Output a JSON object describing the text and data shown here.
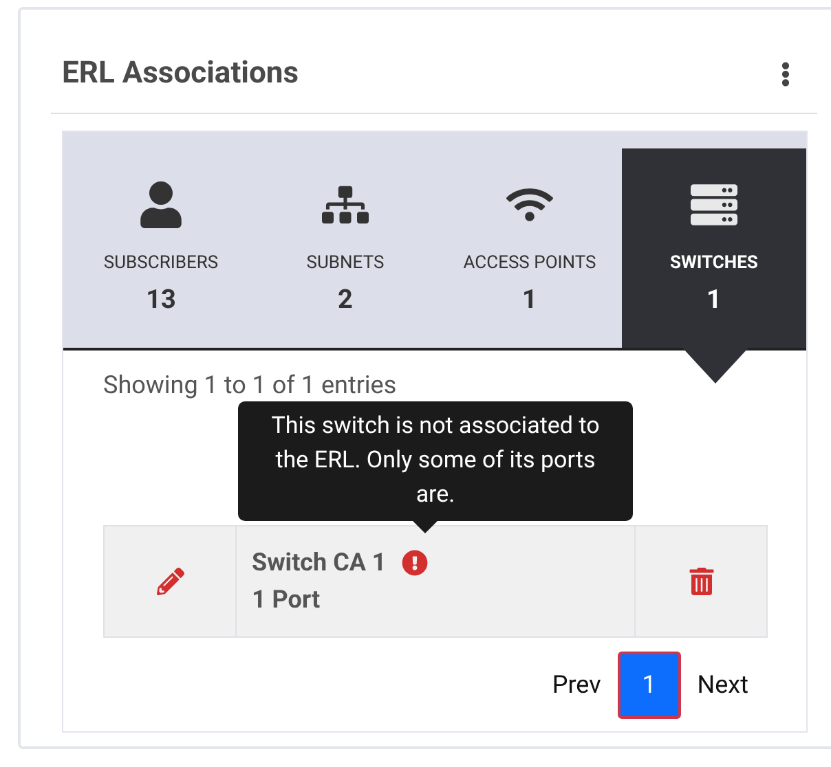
{
  "card": {
    "title": "ERL Associations"
  },
  "tabs": [
    {
      "kind": "subscribers",
      "label": "SUBSCRIBERS",
      "count": "13",
      "selected": false
    },
    {
      "kind": "subnets",
      "label": "SUBNETS",
      "count": "2",
      "selected": false
    },
    {
      "kind": "access_points",
      "label": "ACCESS POINTS",
      "count": "1",
      "selected": false
    },
    {
      "kind": "switches",
      "label": "SWITCHES",
      "count": "1",
      "selected": true
    }
  ],
  "summary": "Showing 1 to 1 of 1 entries",
  "rows": [
    {
      "name": "Switch CA 1",
      "ports": "1 Port",
      "warning": true
    }
  ],
  "tooltip": "This switch is not associated to the ERL. Only some of its ports are.",
  "pagination": {
    "prev": "Prev",
    "pages": [
      {
        "label": "1",
        "selected": true
      }
    ],
    "next": "Next"
  }
}
